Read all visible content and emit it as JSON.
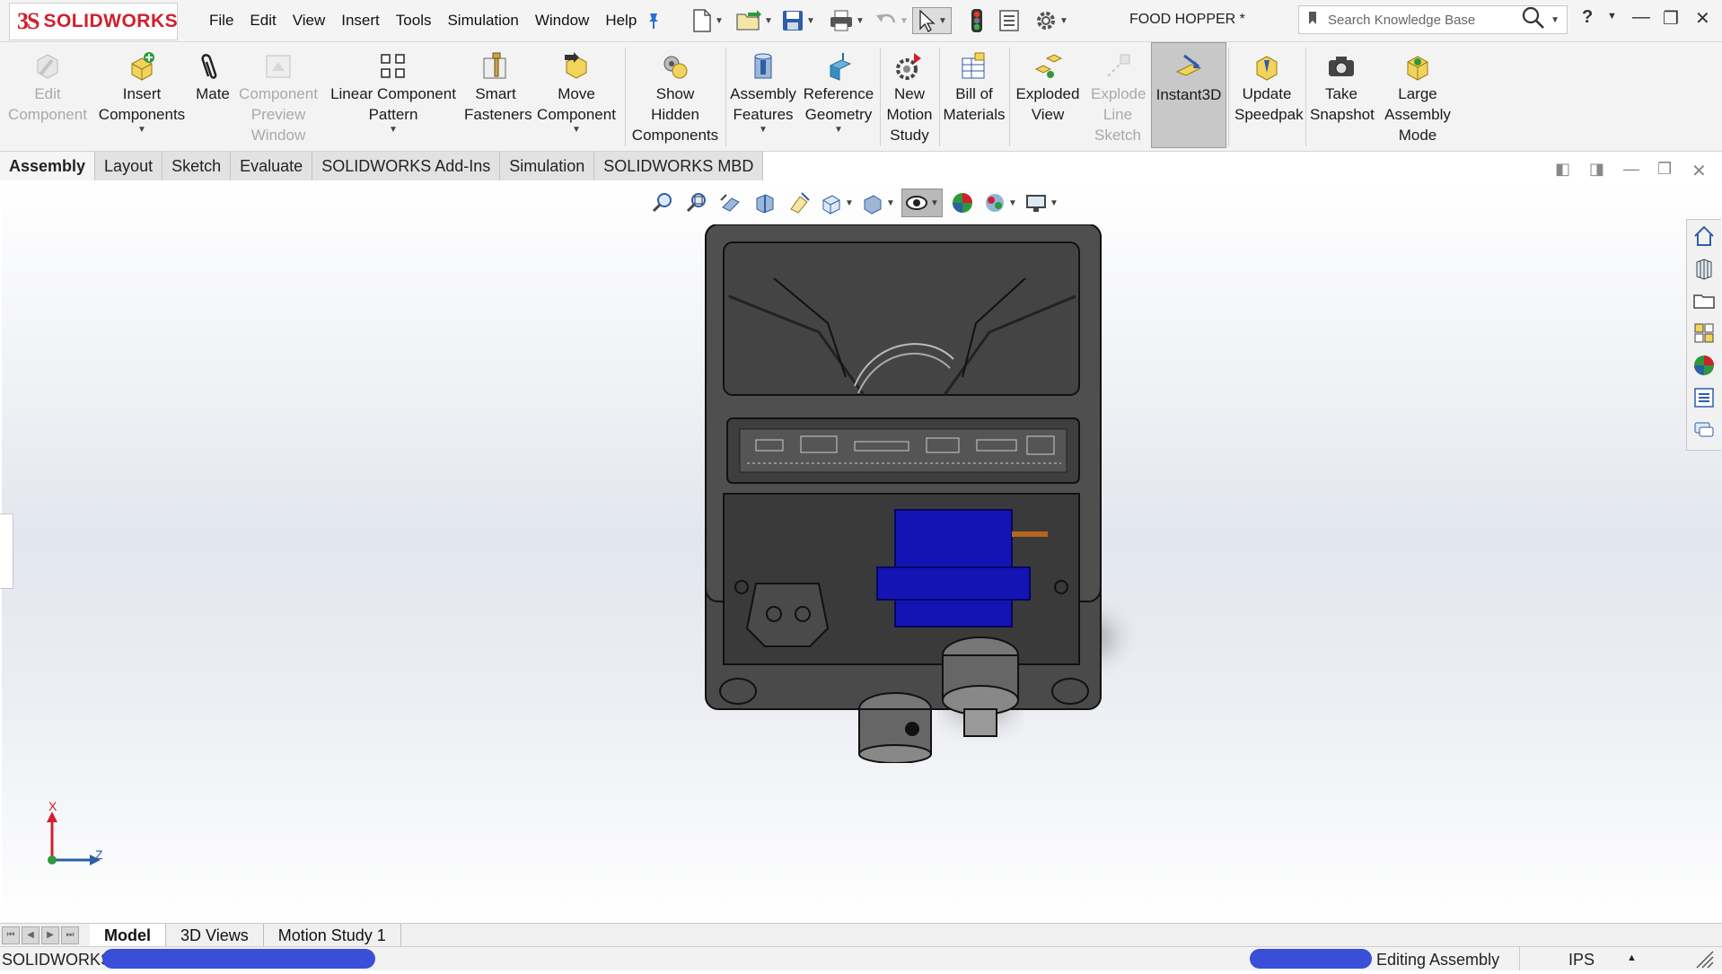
{
  "app": {
    "logo_ds": "3S",
    "logo_text": "SOLIDWORKS",
    "document_title": "FOOD HOPPER *"
  },
  "menu": [
    "File",
    "Edit",
    "View",
    "Insert",
    "Tools",
    "Simulation",
    "Window",
    "Help"
  ],
  "search": {
    "placeholder": "Search Knowledge Base"
  },
  "help_label": "?",
  "command_manager": [
    {
      "label": "Edit Component",
      "enabled": false,
      "icon": "edit-component-icon"
    },
    {
      "label": "Insert Components",
      "enabled": true,
      "icon": "insert-components-icon",
      "dropdown": true
    },
    {
      "label": "Mate",
      "enabled": true,
      "icon": "mate-paperclip-icon"
    },
    {
      "label": "Component Preview Window",
      "enabled": false,
      "icon": "component-preview-icon"
    },
    {
      "label": "Linear Component Pattern",
      "enabled": true,
      "icon": "linear-pattern-icon",
      "dropdown": true
    },
    {
      "label": "Smart Fasteners",
      "enabled": true,
      "icon": "smart-fasteners-icon"
    },
    {
      "label": "Move Component",
      "enabled": true,
      "icon": "move-component-icon",
      "dropdown": true
    },
    {
      "label": "Show Hidden Components",
      "enabled": true,
      "icon": "show-hidden-icon"
    },
    {
      "label": "Assembly Features",
      "enabled": true,
      "icon": "assembly-features-icon",
      "dropdown": true
    },
    {
      "label": "Reference Geometry",
      "enabled": true,
      "icon": "reference-geometry-icon",
      "dropdown": true
    },
    {
      "label": "New Motion Study",
      "enabled": true,
      "icon": "motion-study-icon"
    },
    {
      "label": "Bill of Materials",
      "enabled": true,
      "icon": "bill-of-materials-icon"
    },
    {
      "label": "Exploded View",
      "enabled": true,
      "icon": "exploded-view-icon"
    },
    {
      "label": "Explode Line Sketch",
      "enabled": false,
      "icon": "explode-line-icon"
    },
    {
      "label": "Instant3D",
      "enabled": true,
      "icon": "instant3d-icon",
      "active": true
    },
    {
      "label": "Update Speedpak",
      "enabled": true,
      "icon": "speedpak-icon"
    },
    {
      "label": "Take Snapshot",
      "enabled": true,
      "icon": "camera-icon"
    },
    {
      "label": "Large Assembly Mode",
      "enabled": true,
      "icon": "large-assembly-icon"
    }
  ],
  "tabs": [
    "Assembly",
    "Layout",
    "Sketch",
    "Evaluate",
    "SOLIDWORKS Add-Ins",
    "Simulation",
    "SOLIDWORKS MBD"
  ],
  "selected_tab": "Assembly",
  "triad": {
    "x_label": "X",
    "z_label": "Z"
  },
  "bottom_tabs": [
    "Model",
    "3D Views",
    "Motion Study 1"
  ],
  "selected_bottom_tab": "Model",
  "status": {
    "app_name": "SOLIDWORKS",
    "mode": "Editing Assembly",
    "units": "IPS"
  },
  "colors": {
    "brand": "#d0202e",
    "model_body": "#4a4a4a",
    "servo": "#1414b4",
    "redaction": "#3a4fd8"
  }
}
